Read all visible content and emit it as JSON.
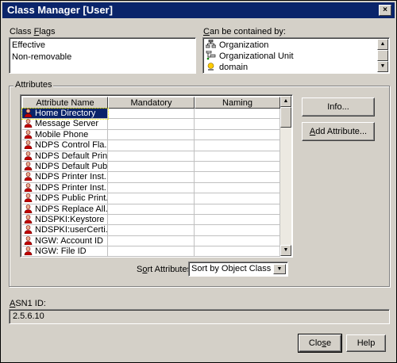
{
  "window": {
    "title": "Class Manager [User]",
    "close_glyph": "×"
  },
  "class_flags": {
    "label_pre": "Class ",
    "label_key": "F",
    "label_post": "lags",
    "items": [
      "Effective",
      "Non-removable"
    ]
  },
  "contained_by": {
    "label_pre": "",
    "label_key": "C",
    "label_post": "an be contained by:",
    "items": [
      {
        "label": "Organization",
        "icon": "organization-icon"
      },
      {
        "label": "Organizational Unit",
        "icon": "organizational-unit-icon"
      },
      {
        "label": "domain",
        "icon": "domain-icon"
      }
    ]
  },
  "attributes": {
    "group_label": "Attributes",
    "columns": [
      "Attribute Name",
      "Mandatory",
      "Naming"
    ],
    "rows": [
      {
        "name": "Home Directory",
        "mandatory": "",
        "naming": "",
        "selected": true
      },
      {
        "name": "Message Server",
        "mandatory": "",
        "naming": ""
      },
      {
        "name": "Mobile Phone",
        "mandatory": "",
        "naming": ""
      },
      {
        "name": "NDPS Control Fla...",
        "mandatory": "",
        "naming": ""
      },
      {
        "name": "NDPS Default Prin...",
        "mandatory": "",
        "naming": ""
      },
      {
        "name": "NDPS Default Pub...",
        "mandatory": "",
        "naming": ""
      },
      {
        "name": "NDPS Printer Inst...",
        "mandatory": "",
        "naming": ""
      },
      {
        "name": "NDPS Printer Inst...",
        "mandatory": "",
        "naming": ""
      },
      {
        "name": "NDPS Public Print...",
        "mandatory": "",
        "naming": ""
      },
      {
        "name": "NDPS Replace All...",
        "mandatory": "",
        "naming": ""
      },
      {
        "name": "NDSPKI:Keystore",
        "mandatory": "",
        "naming": ""
      },
      {
        "name": "NDSPKI:userCerti...",
        "mandatory": "",
        "naming": ""
      },
      {
        "name": "NGW: Account ID",
        "mandatory": "",
        "naming": ""
      },
      {
        "name": "NGW: File ID",
        "mandatory": "",
        "naming": ""
      }
    ],
    "info_button": "Info...",
    "add_attribute_pre": "",
    "add_attribute_key": "A",
    "add_attribute_post": "dd Attribute...",
    "sort_label_pre": "S",
    "sort_label_key": "o",
    "sort_label_post": "rt Attributes",
    "sort_value": "Sort by Object Class"
  },
  "asn1": {
    "label_pre": "",
    "label_key": "A",
    "label_post": "SN1 ID:",
    "value": "2.5.6.10"
  },
  "buttons": {
    "close_pre": "Clo",
    "close_key": "s",
    "close_post": "e",
    "help": "Help"
  },
  "colors": {
    "title_bar": "#0a246a",
    "selection": "#0a246a",
    "face": "#d4d0c8"
  }
}
